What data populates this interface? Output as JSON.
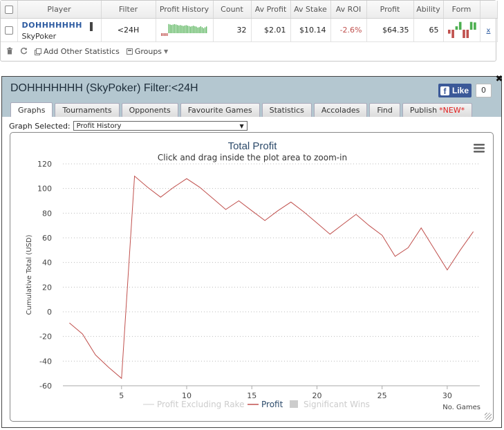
{
  "stats_table": {
    "headers": [
      "Player",
      "Filter",
      "Profit History",
      "Count",
      "Av Profit",
      "Av Stake",
      "Av ROI",
      "Profit",
      "Ability",
      "Form"
    ],
    "row": {
      "player_name": "DOHHHHHHH",
      "player_site": "SkyPoker",
      "filter": "<24H",
      "count": "32",
      "av_profit": "$2.01",
      "av_stake": "$10.14",
      "av_roi": "-2.6%",
      "profit": "$64.35",
      "ability": "65",
      "remove_label": "x"
    },
    "toolbar": {
      "add_label": "Add Other Statistics",
      "groups_label": "Groups"
    },
    "colors": {
      "negative": "#c0504d",
      "sparkline": "#4caf50",
      "form_up": "#4caf50",
      "form_down": "#c0504d"
    }
  },
  "popup": {
    "title": "DOHHHHHHH (SkyPoker) Filter:<24H",
    "like_label": "Like",
    "like_count": "0",
    "close_label": "✖",
    "tabs": [
      {
        "label": "Graphs",
        "active": true
      },
      {
        "label": "Tournaments"
      },
      {
        "label": "Opponents"
      },
      {
        "label": "Favourite Games"
      },
      {
        "label": "Statistics"
      },
      {
        "label": "Accolades"
      },
      {
        "label": "Find"
      },
      {
        "label": "Publish",
        "badge": "*NEW*"
      }
    ],
    "graph_select_label": "Graph Selected:",
    "graph_select_value": "Profit History"
  },
  "chart_data": {
    "type": "line",
    "title": "Total Profit",
    "subtitle": "Click and drag inside the plot area to zoom-in",
    "xlabel": "No. Games",
    "ylabel": "Cumulative Total (USD)",
    "xlim": [
      0.5,
      32.5
    ],
    "ylim": [
      -60,
      120
    ],
    "yticks": [
      -60,
      -40,
      -20,
      0,
      20,
      40,
      60,
      80,
      100,
      120
    ],
    "xticks": [
      5,
      10,
      15,
      20,
      25,
      30
    ],
    "grid": true,
    "legend_position": "bottom",
    "legend": [
      {
        "name": "Profit Excluding Rake",
        "color": "#dddddd",
        "enabled": false
      },
      {
        "name": "Profit",
        "color": "#c0504d",
        "enabled": true
      },
      {
        "name": "Significant Wins",
        "color": "#cccccc",
        "enabled": false,
        "symbol": "box"
      }
    ],
    "series": [
      {
        "name": "Profit",
        "color": "#c0504d",
        "x": [
          1,
          2,
          3,
          4,
          5,
          6,
          7,
          8,
          9,
          10,
          11,
          12,
          13,
          14,
          15,
          16,
          17,
          18,
          19,
          20,
          21,
          22,
          23,
          24,
          25,
          26,
          27,
          28,
          29,
          30,
          31,
          32
        ],
        "values": [
          -9,
          -18,
          -35,
          -45,
          -54,
          110,
          101,
          93,
          101,
          108,
          101,
          92,
          83,
          90,
          82,
          74,
          82,
          89,
          81,
          72,
          63,
          71,
          79,
          70,
          62,
          45,
          52,
          68,
          51,
          34,
          50,
          65
        ]
      }
    ],
    "menu_icon": "hamburger-menu-icon"
  }
}
